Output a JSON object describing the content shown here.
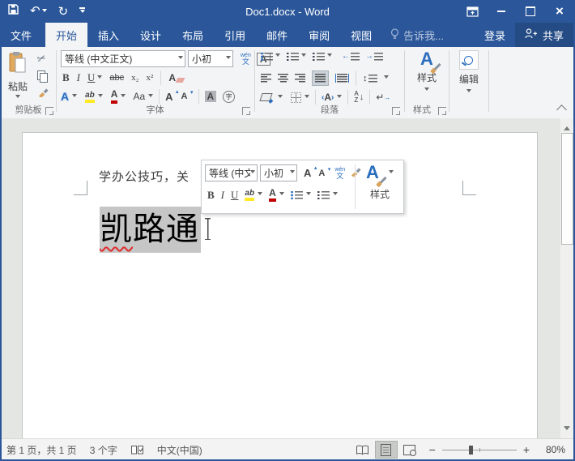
{
  "colors": {
    "titlebar": "#2b579a",
    "ribbon_bg": "#f3f4f6",
    "doc_bg": "#e4e6e3",
    "selection_gray": "#c6c6c6",
    "accent_blue": "#2a6dbe",
    "highlight_yellow": "#ffe926",
    "font_color_red": "#c00000",
    "spellcheck_red": "#e02b2b"
  },
  "titlebar": {
    "title": "Doc1.docx - Word"
  },
  "tabs": {
    "file": "文件",
    "home": "开始",
    "insert": "插入",
    "design": "设计",
    "layout": "布局",
    "references": "引用",
    "mailings": "邮件",
    "review": "审阅",
    "view": "视图",
    "tellme": "告诉我...",
    "signin": "登录",
    "share": "共享"
  },
  "ribbon": {
    "clipboard": {
      "group": "剪贴板",
      "paste": "粘贴"
    },
    "font": {
      "group": "字体",
      "name": "等线 (中文正文)",
      "size": "小初",
      "bold": "B",
      "italic": "I",
      "underline": "U",
      "strikethrough": "abc",
      "subscript": "x₂",
      "superscript": "x²",
      "clear": "A",
      "effects": "A",
      "highlight": "ab",
      "color": "A",
      "case": "Aa",
      "grow": "A",
      "shrink": "A",
      "shading": "A",
      "border": "A",
      "enclose": "字",
      "phonetic_top": "wén",
      "phonetic_bottom": "文"
    },
    "paragraph": {
      "group": "段落",
      "cjk_layout": "A",
      "sort_a": "A",
      "sort_z": "Z"
    },
    "styles": {
      "group": "样式",
      "button": "样式"
    },
    "editing": {
      "button": "编辑"
    }
  },
  "mini": {
    "name": "等线 (中文",
    "size": "小初",
    "styles": "样式"
  },
  "doc": {
    "heading": "学办公技巧，关",
    "selected_1": "凯",
    "selected_rest": "路通"
  },
  "status": {
    "page": "第 1 页，共 1 页",
    "words": "3 个字",
    "language": "中文(中国)",
    "zoom": "80%",
    "zoom_out": "−",
    "zoom_in": "+"
  }
}
